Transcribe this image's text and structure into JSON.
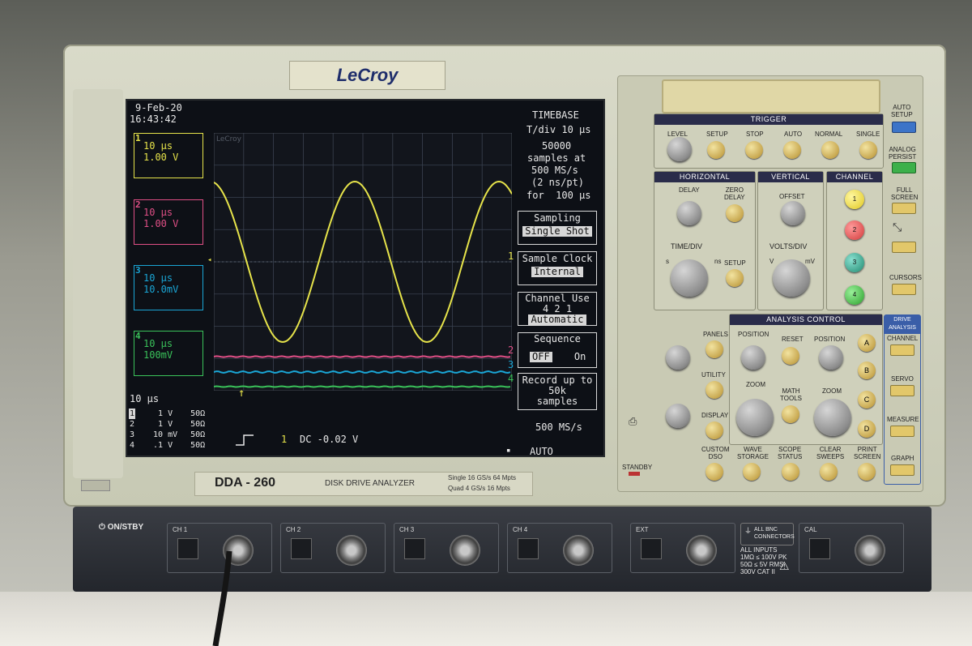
{
  "brand": "LeCroy",
  "model": {
    "name": "DDA - 260",
    "desc": "DISK DRIVE ANALYZER",
    "spec1": "Single 16 GS/s 64 Mpts",
    "spec2": "Quad   4 GS/s 16 Mpts"
  },
  "screen": {
    "date": "9-Feb-20",
    "time": "16:43:42",
    "grid_logo": "LeCroy",
    "channels": [
      {
        "num": "1",
        "line1": "10 μs",
        "line2": "1.00 V",
        "color": "#e6e34a"
      },
      {
        "num": "2",
        "line1": "10 μs",
        "line2": "1.00 V",
        "color": "#e04f86"
      },
      {
        "num": "3",
        "line1": "10 μs",
        "line2": "10.0mV",
        "color": "#1aa6d6"
      },
      {
        "num": "4",
        "line1": "10 μs",
        "line2": "100mV",
        "color": "#3ac25a"
      }
    ],
    "timebase": {
      "title": "TIMEBASE",
      "tdiv": "T/div 10 μs",
      "samples": "50000",
      "samples_at": "samples at",
      "rate": "500 MS/s",
      "nspt": "(2 ns/pt)",
      "for": "for  100 μs"
    },
    "sampling": {
      "title": "Sampling",
      "value": "Single Shot"
    },
    "sample_clock": {
      "title": "Sample Clock",
      "value": "Internal"
    },
    "channel_use": {
      "title": "Channel Use",
      "opts": "4   2   1",
      "value": "Automatic"
    },
    "sequence": {
      "title": "Sequence",
      "off": "OFF",
      "on": "On"
    },
    "record": {
      "l1": "Record up to",
      "l2": "50k",
      "l3": "samples"
    },
    "rate_bottom": "500 MS/s",
    "mode": "AUTO",
    "timediv_bottom": "10 μs",
    "ch_summary": [
      {
        "n": "1",
        "v": "1",
        "u": "V",
        "c": "50Ω"
      },
      {
        "n": "2",
        "v": "1",
        "u": "V",
        "c": "50Ω"
      },
      {
        "n": "3",
        "v": "10",
        "u": "mV",
        "c": "50Ω"
      },
      {
        "n": "4",
        "v": ".1",
        "u": "V",
        "c": "50Ω"
      }
    ],
    "trigger_info": {
      "ch": "1",
      "text": "DC -0.02 V"
    },
    "marker_labels": [
      "1",
      "2",
      "3",
      "4"
    ]
  },
  "panel": {
    "trigger": {
      "title": "TRIGGER",
      "labels": [
        "LEVEL",
        "SETUP",
        "STOP",
        "AUTO",
        "NORMAL",
        "SINGLE"
      ]
    },
    "horizontal": {
      "title": "HORIZONTAL",
      "delay": "DELAY",
      "zero_delay": "ZERO\nDELAY",
      "time_div": "TIME/DIV",
      "setup": "SETUP",
      "ns": "ns",
      "s": "s"
    },
    "vertical": {
      "title": "VERTICAL",
      "offset": "OFFSET",
      "volts_div": "VOLTS/DIV",
      "v": "V",
      "mv": "mV"
    },
    "channel": {
      "title": "CHANNEL",
      "buttons": [
        "1",
        "2",
        "3",
        "4"
      ]
    },
    "analysis": {
      "title": "ANALYSIS CONTROL",
      "position": "POSITION",
      "reset": "RESET",
      "position2": "POSITION",
      "zoom": "ZOOM",
      "math": "MATH\nTOOLS",
      "zoom2": "ZOOM",
      "letters": [
        "A",
        "B",
        "C",
        "D"
      ]
    },
    "left_col": [
      "PANELS",
      "UTILITY",
      "DISPLAY",
      "CUSTOM\nDSO"
    ],
    "bottom_row": [
      "WAVE\nSTORAGE",
      "SCOPE\nSTATUS",
      "CLEAR\nSWEEPS",
      "PRINT\nSCREEN"
    ],
    "right_col": [
      "AUTO\nSETUP",
      "ANALOG\nPERSIST",
      "FULL\nSCREEN",
      "CURSORS"
    ],
    "drive": {
      "title": "DRIVE\nANALYSIS",
      "items": [
        "CHANNEL",
        "SERVO",
        "MEASURE",
        "GRAPH"
      ]
    },
    "standby": "STANDBY"
  },
  "front": {
    "power": "ON/STBY",
    "inputs": [
      "CH 1",
      "CH 2",
      "CH 3",
      "CH 4",
      "EXT",
      "CAL"
    ],
    "all_bnc": "ALL BNC\nCONNECTORS",
    "all_inputs": "ALL INPUTS\n1MΩ ≤ 100V PK\n50Ω ≤ 5V RMS\n300V CAT II"
  }
}
